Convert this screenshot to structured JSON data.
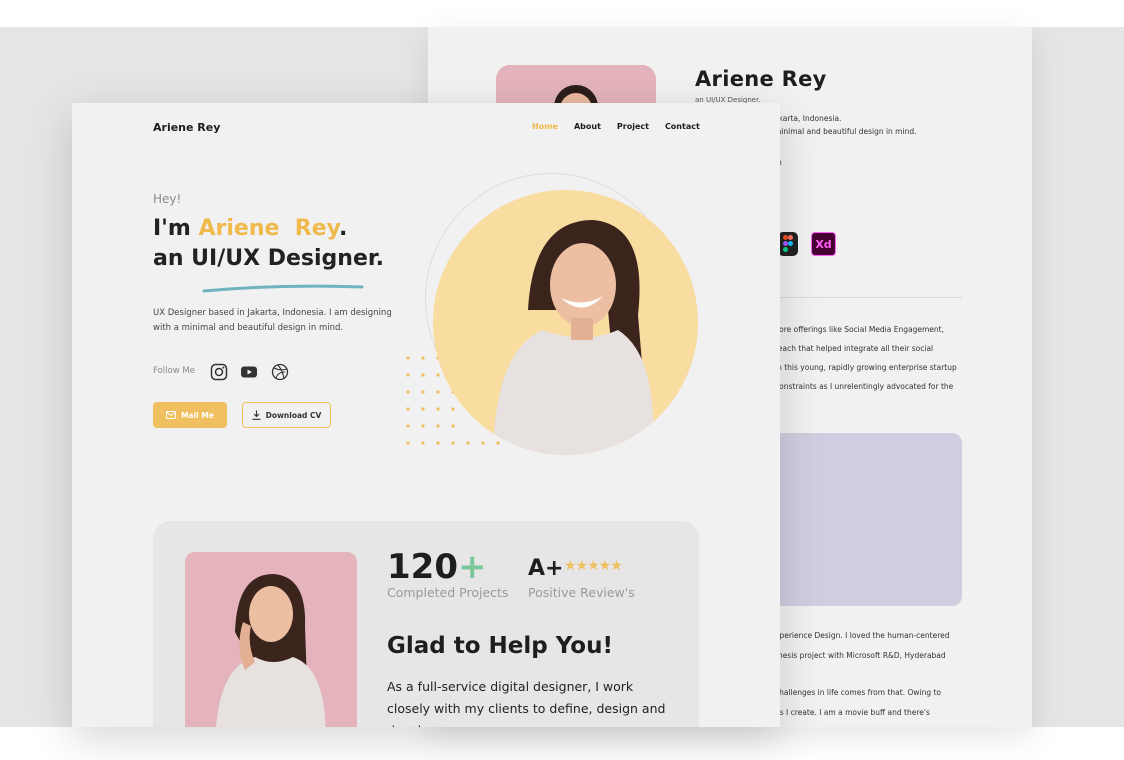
{
  "back_card": {
    "name": "Ariene Rey",
    "role": "an UI/UX Designer.",
    "intro_lines": [
      "akarta, Indonesia.",
      "minimal and beautiful design in mind."
    ],
    "fragment": "n",
    "tool_icons": [
      "figma-icon",
      "adobe-xd-icon"
    ],
    "xd_label": "Xd",
    "para1": [
      "core offerings like Social Media Engagement,",
      "reach that helped integrate all their social",
      "in this young, rapidly growing enterprise startup",
      "constraints as I unrelentingly advocated for the"
    ],
    "para2": [
      "xperience Design. I loved the human-centered",
      "thesis project with Microsoft R&D, Hyderabad"
    ],
    "para3": [
      "challenges in life comes from that. Owing to",
      "ns I create. I am a movie buff and there's"
    ]
  },
  "header": {
    "logo": "Ariene Rey",
    "nav": [
      "Home",
      "About",
      "Project",
      "Contact"
    ],
    "active_nav": "Home"
  },
  "hero": {
    "greeting": "Hey!",
    "title_prefix": "I'm ",
    "title_name": "Ariene  Rey",
    "title_suffix": ".",
    "title_line2": "an UI/UX Designer.",
    "intro": "UX Designer based in Jakarta, Indonesia. I am designing with a minimal and beautiful design in mind.",
    "follow_label": "Follow Me",
    "social_icons": [
      "instagram-icon",
      "youtube-icon",
      "dribbble-icon"
    ],
    "mail_button": "Mail Me",
    "cv_button": "Download CV"
  },
  "about": {
    "projects_count": "120",
    "projects_plus": "+",
    "projects_label": "Completed Projects",
    "review_grade": "A+",
    "review_stars": "★★★★★",
    "review_label": "Positive Review's",
    "heading": "Glad to Help You!",
    "paragraph": "As a full-service digital designer, I work closely with my clients to define, design and develop"
  },
  "colors": {
    "accent": "#f0b94b",
    "hero_circle": "#f8dca0",
    "photo_bg": "#e4b3bb",
    "plus_green": "#7cc79a",
    "card_purple": "#d1cde0"
  }
}
